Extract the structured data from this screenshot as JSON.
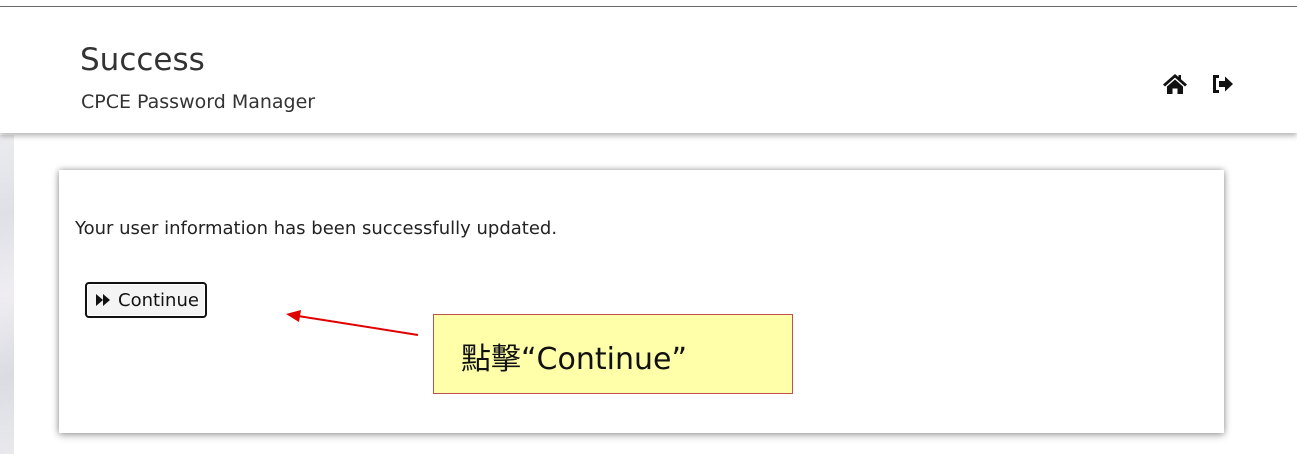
{
  "header": {
    "title": "Success",
    "subtitle": "CPCE Password Manager",
    "icons": [
      "home-icon",
      "logout-icon"
    ]
  },
  "content": {
    "message": "Your user information has been successfully updated.",
    "continue_label": "Continue",
    "continue_icon": "fast-forward-icon"
  },
  "annotation": {
    "text": "點擊“Continue”",
    "background": "#ffffaa",
    "border": "#c0504d",
    "arrow_color": "#e00000"
  }
}
